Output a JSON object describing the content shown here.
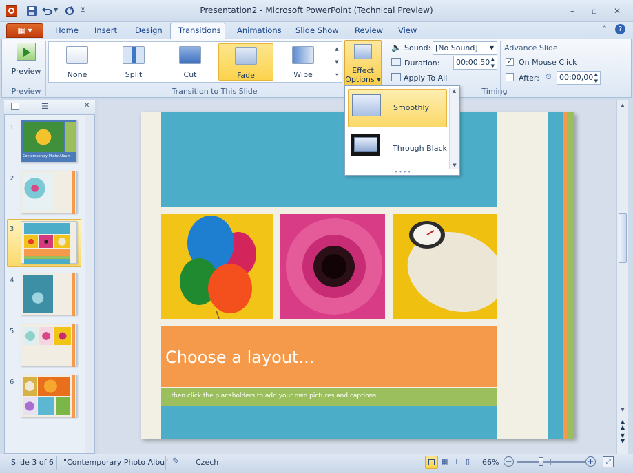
{
  "window": {
    "title": "Presentation2  -  Microsoft PowerPoint (Technical Preview)",
    "controls": [
      "minimize-icon",
      "maximize-icon",
      "close-icon"
    ]
  },
  "quick_access": [
    "save-icon",
    "undo-icon",
    "redo-icon",
    "customize-icon"
  ],
  "ribbon": {
    "tabs": [
      "Home",
      "Insert",
      "Design",
      "Transitions",
      "Animations",
      "Slide Show",
      "Review",
      "View"
    ],
    "active_tab": "Transitions",
    "preview": {
      "label": "Preview",
      "group": "Preview"
    },
    "gallery": {
      "group": "Transition to This Slide",
      "items": [
        "None",
        "Split",
        "Cut",
        "Fade",
        "Wipe"
      ],
      "selected": "Fade"
    },
    "effect_options": {
      "line1": "Effect",
      "line2": "Options"
    },
    "timing": {
      "group": "Timing",
      "sound_label": "Sound:",
      "sound_value": "[No Sound]",
      "duration_label": "Duration:",
      "duration_value": "00:00,50",
      "apply_all": "Apply To All",
      "advance_title": "Advance Slide",
      "on_mouse_click": "On Mouse Click",
      "on_mouse_click_checked": true,
      "after_label": "After:",
      "after_checked": false,
      "after_value": "00:00,00"
    }
  },
  "dropdown": {
    "items": [
      "Smoothly",
      "Through Black"
    ],
    "selected": "Smoothly"
  },
  "slides_pane": {
    "numbers": [
      "1",
      "2",
      "3",
      "4",
      "5",
      "6"
    ],
    "selected": 3,
    "thumb1_caption": "Contemporary Photo Album"
  },
  "slide": {
    "title": "Choose a layout...",
    "subtitle": "...then click the placeholders to add your own pictures and captions.",
    "colors": {
      "blue": "#4badc8",
      "orange": "#f59a4a",
      "green": "#9bbf5d",
      "cream": "#f2efe4"
    }
  },
  "status": {
    "slide_of": "Slide 3 of 6",
    "theme": "\"Contemporary Photo Albu\"",
    "language": "Czech",
    "zoom": "66%",
    "zoom_fraction": 0.5
  }
}
